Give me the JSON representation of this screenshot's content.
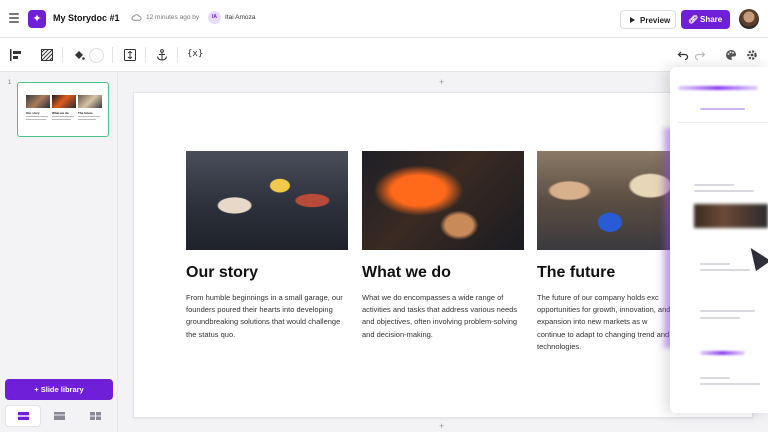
{
  "header": {
    "doc_title": "My Storydoc #1",
    "saved_status": "12 minutes ago by",
    "author_initials": "IA",
    "author_name": "Itai Amoza",
    "preview_label": "Preview",
    "share_label": "Share"
  },
  "toolbar": {
    "variables_label": "{x}",
    "icons": [
      "align-left-icon",
      "pattern-icon",
      "fill-bucket-icon",
      "color-swatch",
      "height-icon",
      "anchor-icon",
      "variables-icon",
      "undo-icon",
      "redo-icon",
      "palette-icon",
      "settings-icon"
    ]
  },
  "left_panel": {
    "slide_number": "1",
    "thumbnail_titles": [
      "Our story",
      "What we do",
      "The future"
    ],
    "slide_library_label": "Slide library",
    "view_modes": [
      "single-view",
      "wide-view",
      "grid-view"
    ]
  },
  "slide": {
    "columns": [
      {
        "title": "Our story",
        "text": "From humble beginnings in a small garage, our founders poured their hearts into developing groundbreaking solutions that would challenge the status quo."
      },
      {
        "title": "What we do",
        "text": "What we do encompasses a wide range of activities and tasks that address various needs and objectives, often involving problem-solving and decision-making."
      },
      {
        "title": "The future",
        "text": "The future of our company holds exc opportunities for growth, innovation, and expansion into new markets as w continue to adapt to changing trend and technologies."
      }
    ]
  },
  "colors": {
    "accent": "#6f1fd8",
    "selection": "#4cc38a"
  }
}
